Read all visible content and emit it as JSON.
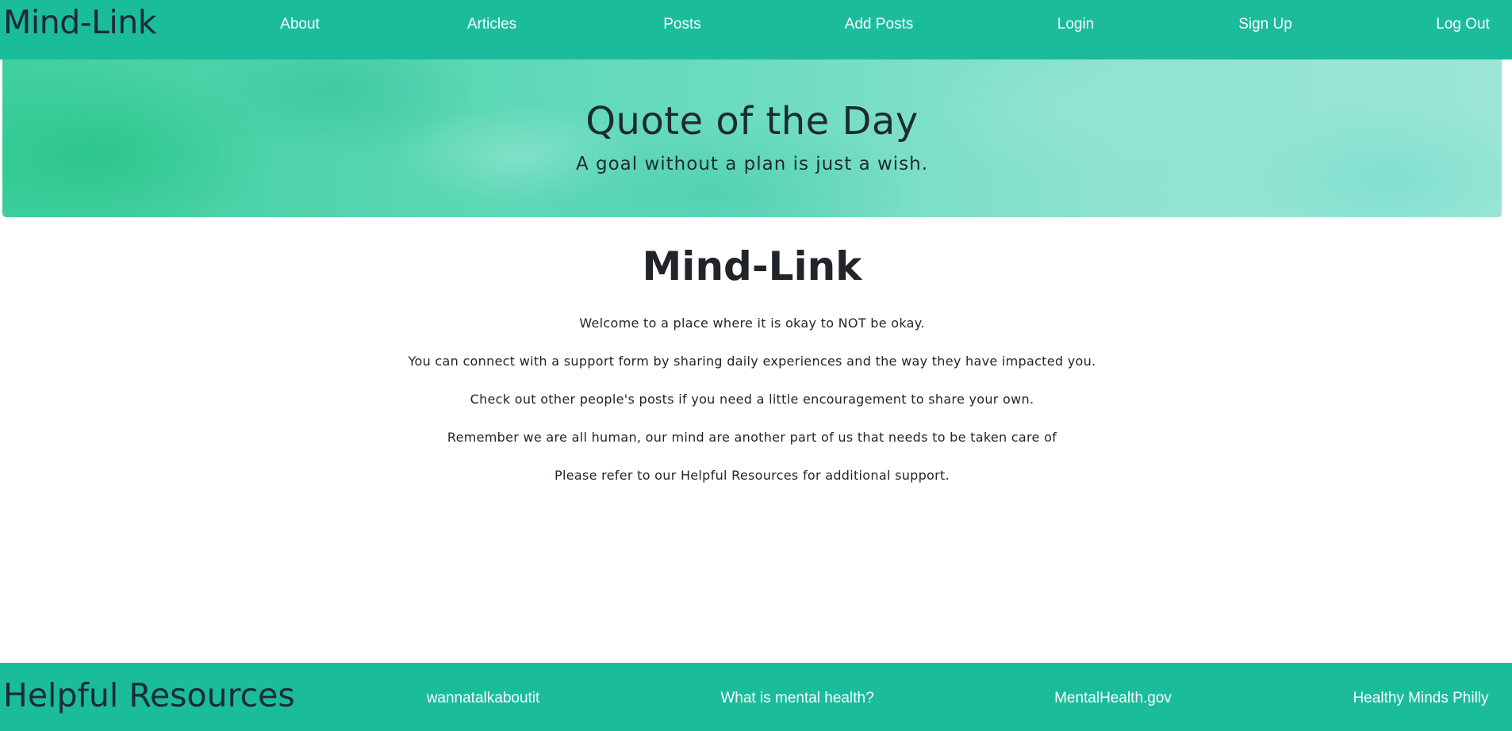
{
  "navbar": {
    "brand": "Mind-Link",
    "links": [
      {
        "label": "About"
      },
      {
        "label": "Articles"
      },
      {
        "label": "Posts"
      },
      {
        "label": "Add Posts"
      },
      {
        "label": "Login"
      },
      {
        "label": "Sign Up"
      },
      {
        "label": "Log Out"
      }
    ]
  },
  "hero": {
    "title": "Quote of the Day",
    "quote": "A goal without a plan is just a wish."
  },
  "main": {
    "title": "Mind-Link",
    "paragraphs": [
      "Welcome to a place where it is okay to NOT be okay.",
      "You can connect with a support form by sharing daily experiences and the way they have impacted you.",
      "Check out other people's posts if you need a little encouragement to share your own.",
      "Remember we are all human, our mind are another part of us that needs to be taken care of",
      "Please refer to our Helpful Resources for additional support."
    ]
  },
  "footer": {
    "title": "Helpful Resources",
    "links": [
      {
        "label": "wannatalkaboutit"
      },
      {
        "label": "What is mental health?"
      },
      {
        "label": "MentalHealth.gov"
      },
      {
        "label": "Healthy Minds Philly"
      }
    ]
  },
  "colors": {
    "nav_background": "#1abc9c",
    "footer_background": "#1abc9c",
    "link_text": "#ffffff",
    "heading_text": "#212529"
  }
}
